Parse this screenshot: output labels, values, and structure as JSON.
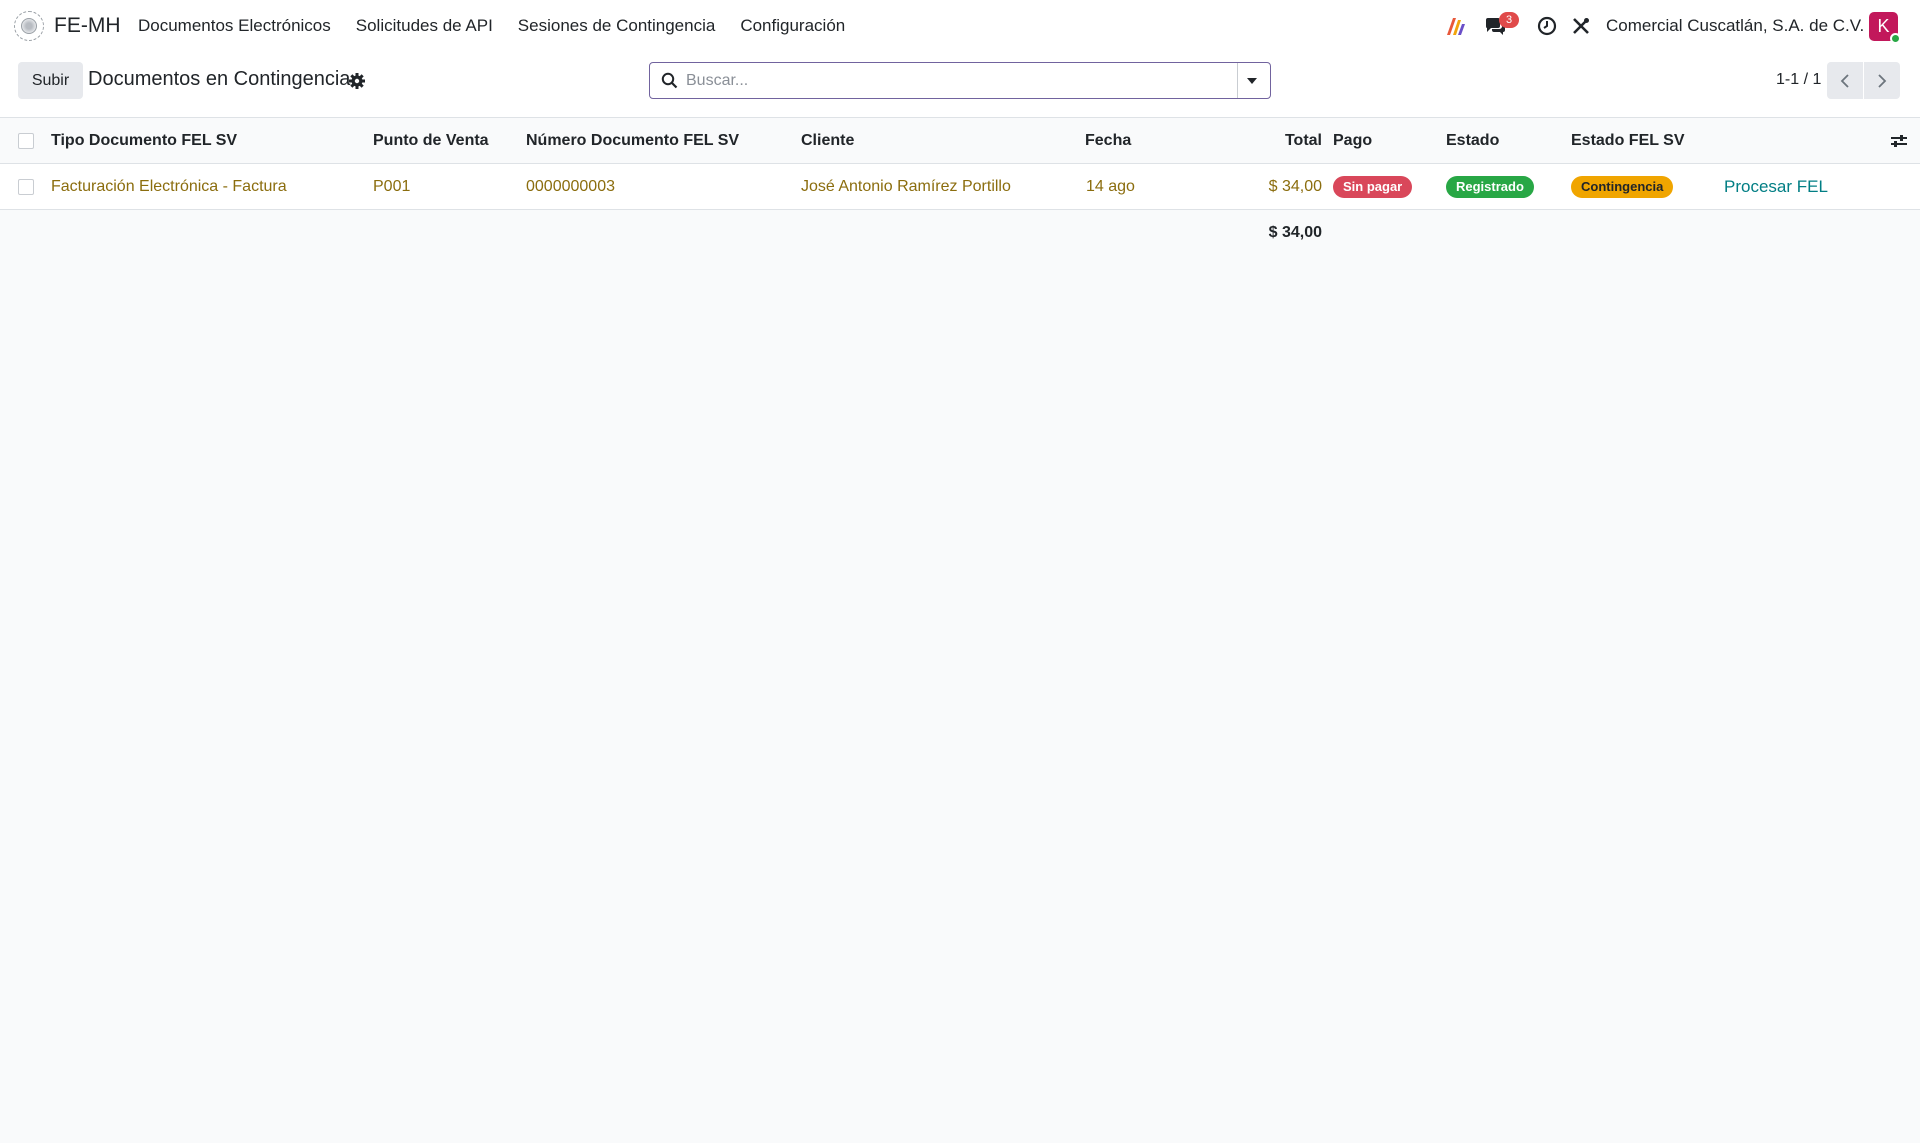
{
  "app": {
    "name": "FE-MH",
    "logo_icon": "seal-icon"
  },
  "menu": [
    "Documentos Electrónicos",
    "Solicitudes de API",
    "Sesiones de Contingencia",
    "Configuración"
  ],
  "tray": {
    "messages_count": "3",
    "company": "Comercial Cuscatlán, S.A. de C.V.",
    "avatar_letter": "K"
  },
  "control": {
    "upload_label": "Subir",
    "title": "Documentos en Contingencia",
    "search_placeholder": "Buscar...",
    "pager": "1-1 / 1"
  },
  "table": {
    "headers": {
      "tipo": "Tipo Documento FEL SV",
      "punto": "Punto de Venta",
      "numero": "Número Documento FEL SV",
      "cliente": "Cliente",
      "fecha": "Fecha",
      "total": "Total",
      "pago": "Pago",
      "estado": "Estado",
      "estado_fel": "Estado FEL SV"
    },
    "rows": [
      {
        "tipo": "Facturación Electrónica - Factura",
        "punto": "P001",
        "numero": "0000000003",
        "cliente": "José Antonio Ramírez Portillo",
        "fecha": "14 ago",
        "total": "$ 34,00",
        "pago": "Sin pagar",
        "estado": "Registrado",
        "estado_fel": "Contingencia",
        "action": "Procesar FEL"
      }
    ],
    "footer_total": "$ 34,00"
  },
  "colors": {
    "accent": "#71639e",
    "link": "#8b6d0e",
    "action": "#017e84",
    "unpaid": "#d9475a",
    "registered": "#28a745",
    "contingency": "#f0a500"
  }
}
